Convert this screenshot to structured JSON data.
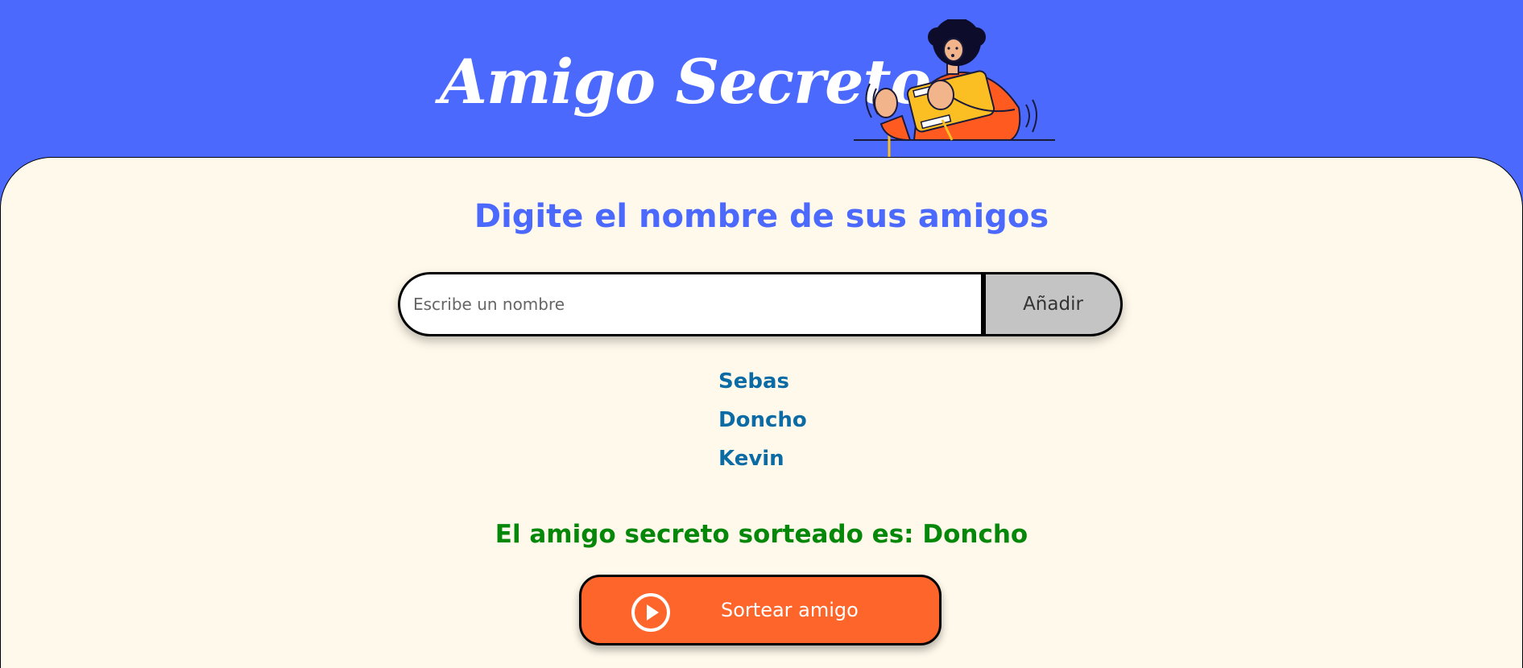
{
  "header": {
    "title": "Amigo Secreto",
    "illustration": "person-playing-handheld-console-illustration"
  },
  "main": {
    "subtitle": "Digite el nombre de sus amigos",
    "name_input": {
      "value": "",
      "placeholder": "Escribe un nombre"
    },
    "add_button_label": "Añadir",
    "friends": [
      "Sebas",
      "Doncho",
      "Kevin"
    ],
    "result_text": "El amigo secreto sorteado es: Doncho",
    "draw_button": {
      "label": "Sortear amigo",
      "icon": "play-circle-icon"
    }
  },
  "colors": {
    "header_bg": "#4B69FD",
    "main_bg": "#FFF9EB",
    "subtitle": "#4B69FD",
    "friend_text": "#0A6BA5",
    "result_text": "#05870A",
    "draw_button_bg": "#FE652B",
    "add_button_bg": "#C4C4C4"
  }
}
